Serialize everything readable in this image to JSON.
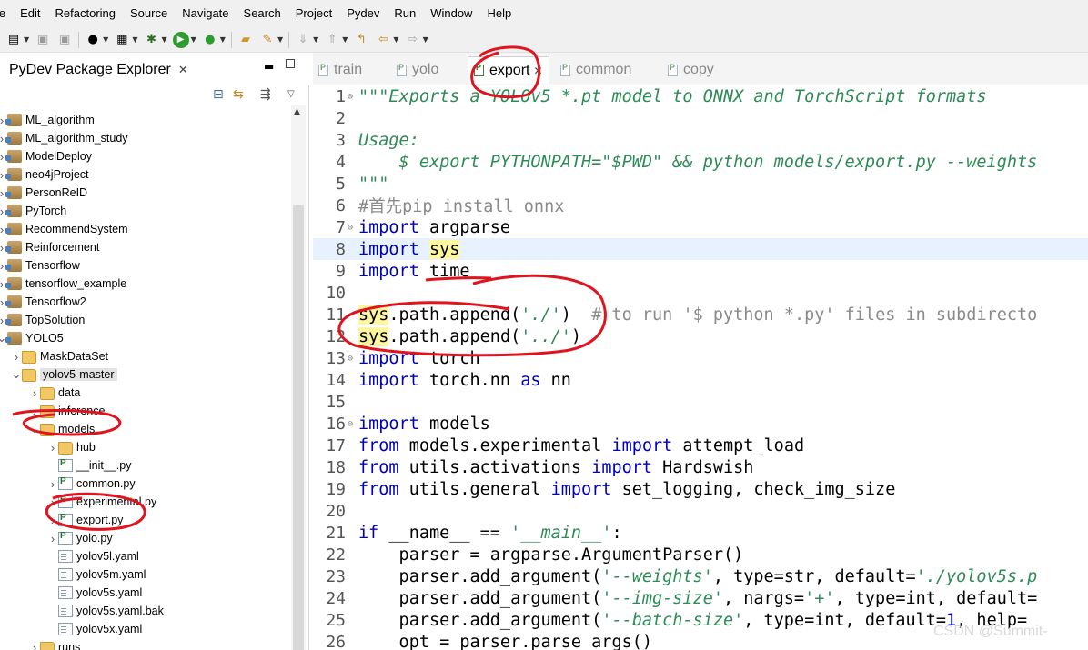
{
  "menubar": [
    "le",
    "Edit",
    "Refactoring",
    "Source",
    "Navigate",
    "Search",
    "Project",
    "Pydev",
    "Run",
    "Window",
    "Help"
  ],
  "explorer": {
    "title": "PyDev Package Explorer",
    "tree": [
      {
        "label": "ML_algorithm",
        "icon": "project-icon",
        "depth": 0,
        "twisty": "collapsed"
      },
      {
        "label": "ML_algorithm_study",
        "icon": "project-icon",
        "depth": 0,
        "twisty": "collapsed"
      },
      {
        "label": "ModelDeploy",
        "icon": "project-icon",
        "depth": 0,
        "twisty": "collapsed"
      },
      {
        "label": "neo4jProject",
        "icon": "project-icon",
        "depth": 0,
        "twisty": "collapsed"
      },
      {
        "label": "PersonReID",
        "icon": "project-icon",
        "depth": 0,
        "twisty": "collapsed"
      },
      {
        "label": "PyTorch",
        "icon": "project-icon",
        "depth": 0,
        "twisty": "collapsed"
      },
      {
        "label": "RecommendSystem",
        "icon": "project-icon",
        "depth": 0,
        "twisty": "collapsed"
      },
      {
        "label": "Reinforcement",
        "icon": "project-icon",
        "depth": 0,
        "twisty": "collapsed"
      },
      {
        "label": "Tensorflow",
        "icon": "project-icon",
        "depth": 0,
        "twisty": "collapsed"
      },
      {
        "label": "tensorflow_example",
        "icon": "project-icon",
        "depth": 0,
        "twisty": "collapsed"
      },
      {
        "label": "Tensorflow2",
        "icon": "project-icon",
        "depth": 0,
        "twisty": "collapsed"
      },
      {
        "label": "TopSolution",
        "icon": "project-icon",
        "depth": 0,
        "twisty": "collapsed"
      },
      {
        "label": "YOLO5",
        "icon": "project-icon",
        "depth": 0,
        "twisty": "expanded"
      },
      {
        "label": "MaskDataSet",
        "icon": "folder-icon",
        "depth": 1,
        "twisty": "collapsed"
      },
      {
        "label": "yolov5-master",
        "icon": "folder-icon",
        "depth": 1,
        "twisty": "expanded",
        "selected": true
      },
      {
        "label": "data",
        "icon": "folder-icon",
        "depth": 2,
        "twisty": "collapsed"
      },
      {
        "label": "inference",
        "icon": "folder-icon",
        "depth": 2,
        "twisty": "collapsed"
      },
      {
        "label": "models",
        "icon": "folder-icon",
        "depth": 2,
        "twisty": "expanded"
      },
      {
        "label": "hub",
        "icon": "folder-icon",
        "depth": 3,
        "twisty": "collapsed"
      },
      {
        "label": "__init__.py",
        "icon": "python-file-icon",
        "depth": 3,
        "twisty": ""
      },
      {
        "label": "common.py",
        "icon": "python-file-icon",
        "depth": 3,
        "twisty": "collapsed"
      },
      {
        "label": "experimental.py",
        "icon": "python-file-icon",
        "depth": 3,
        "twisty": "collapsed"
      },
      {
        "label": "export.py",
        "icon": "python-file-icon",
        "depth": 3,
        "twisty": "collapsed"
      },
      {
        "label": "yolo.py",
        "icon": "python-file-icon",
        "depth": 3,
        "twisty": "collapsed"
      },
      {
        "label": "yolov5l.yaml",
        "icon": "file-icon",
        "depth": 3,
        "twisty": ""
      },
      {
        "label": "yolov5m.yaml",
        "icon": "file-icon",
        "depth": 3,
        "twisty": ""
      },
      {
        "label": "yolov5s.yaml",
        "icon": "file-icon",
        "depth": 3,
        "twisty": ""
      },
      {
        "label": "yolov5s.yaml.bak",
        "icon": "file-icon",
        "depth": 3,
        "twisty": ""
      },
      {
        "label": "yolov5x.yaml",
        "icon": "file-icon",
        "depth": 3,
        "twisty": ""
      },
      {
        "label": "runs",
        "icon": "folder-icon",
        "depth": 2,
        "twisty": "collapsed"
      }
    ]
  },
  "editor": {
    "tabs": [
      {
        "label": "train",
        "active": false
      },
      {
        "label": "yolo",
        "active": false
      },
      {
        "label": "export",
        "active": true
      },
      {
        "label": "common",
        "active": false
      },
      {
        "label": "copy",
        "active": false
      }
    ],
    "lines": [
      {
        "n": "1",
        "fold": "⊖",
        "parts": [
          [
            "str",
            "\"\"\"Exports a YOLOv5 *.pt model to ONNX and TorchScript formats"
          ]
        ]
      },
      {
        "n": "2",
        "fold": "",
        "parts": []
      },
      {
        "n": "3",
        "fold": "",
        "parts": [
          [
            "str",
            "Usage:"
          ]
        ]
      },
      {
        "n": "4",
        "fold": "",
        "parts": [
          [
            "str",
            "    $ export PYTHONPATH=\"$PWD\" && python models/export.py --weights"
          ]
        ]
      },
      {
        "n": "5",
        "fold": "",
        "parts": [
          [
            "str",
            "\"\"\""
          ]
        ]
      },
      {
        "n": "6",
        "fold": "",
        "parts": [
          [
            "cmt",
            "#首先pip install onnx"
          ]
        ]
      },
      {
        "n": "7",
        "fold": "⊖",
        "parts": [
          [
            "kw",
            "import"
          ],
          [
            "src",
            " argparse"
          ]
        ]
      },
      {
        "n": "8",
        "fold": "",
        "current": true,
        "parts": [
          [
            "kw",
            "import"
          ],
          [
            "src",
            " "
          ],
          [
            "hl",
            "sys"
          ]
        ]
      },
      {
        "n": "9",
        "fold": "",
        "parts": [
          [
            "kw",
            "import"
          ],
          [
            "src",
            " time"
          ]
        ]
      },
      {
        "n": "10",
        "fold": "",
        "parts": []
      },
      {
        "n": "11",
        "fold": "",
        "parts": [
          [
            "hl",
            "sys"
          ],
          [
            "src",
            ".path.append("
          ],
          [
            "str",
            "'./'"
          ],
          [
            "src",
            ")  "
          ],
          [
            "cmt",
            "# to run '$ python *.py' files in subdirecto"
          ]
        ]
      },
      {
        "n": "12",
        "fold": "",
        "parts": [
          [
            "hl",
            "sys"
          ],
          [
            "src",
            ".path.append("
          ],
          [
            "str",
            "'../'"
          ],
          [
            "src",
            ")"
          ]
        ]
      },
      {
        "n": "13",
        "fold": "⊖",
        "parts": [
          [
            "kw",
            "import"
          ],
          [
            "src",
            " torch"
          ]
        ]
      },
      {
        "n": "14",
        "fold": "",
        "parts": [
          [
            "kw",
            "import"
          ],
          [
            "src",
            " torch.nn "
          ],
          [
            "kw",
            "as"
          ],
          [
            "src",
            " nn"
          ]
        ]
      },
      {
        "n": "15",
        "fold": "",
        "parts": []
      },
      {
        "n": "16",
        "fold": "⊖",
        "parts": [
          [
            "kw",
            "import"
          ],
          [
            "src",
            " models"
          ]
        ]
      },
      {
        "n": "17",
        "fold": "",
        "parts": [
          [
            "kw",
            "from"
          ],
          [
            "src",
            " models.experimental "
          ],
          [
            "kw",
            "import"
          ],
          [
            "src",
            " attempt_load"
          ]
        ]
      },
      {
        "n": "18",
        "fold": "",
        "parts": [
          [
            "kw",
            "from"
          ],
          [
            "src",
            " utils.activations "
          ],
          [
            "kw",
            "import"
          ],
          [
            "src",
            " Hardswish"
          ]
        ]
      },
      {
        "n": "19",
        "fold": "",
        "parts": [
          [
            "kw",
            "from"
          ],
          [
            "src",
            " utils.general "
          ],
          [
            "kw",
            "import"
          ],
          [
            "src",
            " set_logging, check_img_size"
          ]
        ]
      },
      {
        "n": "20",
        "fold": "",
        "parts": []
      },
      {
        "n": "21",
        "fold": "",
        "parts": [
          [
            "kw",
            "if"
          ],
          [
            "src",
            " __name__ == "
          ],
          [
            "str",
            "'__main__'"
          ],
          [
            "src",
            ":"
          ]
        ]
      },
      {
        "n": "22",
        "fold": "",
        "parts": [
          [
            "src",
            "    parser = argparse.ArgumentParser()"
          ]
        ]
      },
      {
        "n": "23",
        "fold": "",
        "parts": [
          [
            "src",
            "    parser.add_argument("
          ],
          [
            "str",
            "'--weights'"
          ],
          [
            "src",
            ", type=str, default="
          ],
          [
            "str",
            "'./yolov5s.p"
          ]
        ]
      },
      {
        "n": "24",
        "fold": "",
        "parts": [
          [
            "src",
            "    parser.add_argument("
          ],
          [
            "str",
            "'--img-size'"
          ],
          [
            "src",
            ", nargs="
          ],
          [
            "str",
            "'+'"
          ],
          [
            "src",
            ", type=int, default="
          ]
        ]
      },
      {
        "n": "25",
        "fold": "",
        "parts": [
          [
            "src",
            "    parser.add_argument("
          ],
          [
            "str",
            "'--batch-size'"
          ],
          [
            "src",
            ", type=int, default="
          ],
          [
            "kw",
            "1"
          ],
          [
            "src",
            ", help="
          ]
        ]
      },
      {
        "n": "26",
        "fold": "",
        "parts": [
          [
            "src",
            "    opt = parser.parse_args()"
          ]
        ]
      }
    ]
  },
  "watermark": "CSDN @Summit-",
  "annotation_color": "#e0141e"
}
